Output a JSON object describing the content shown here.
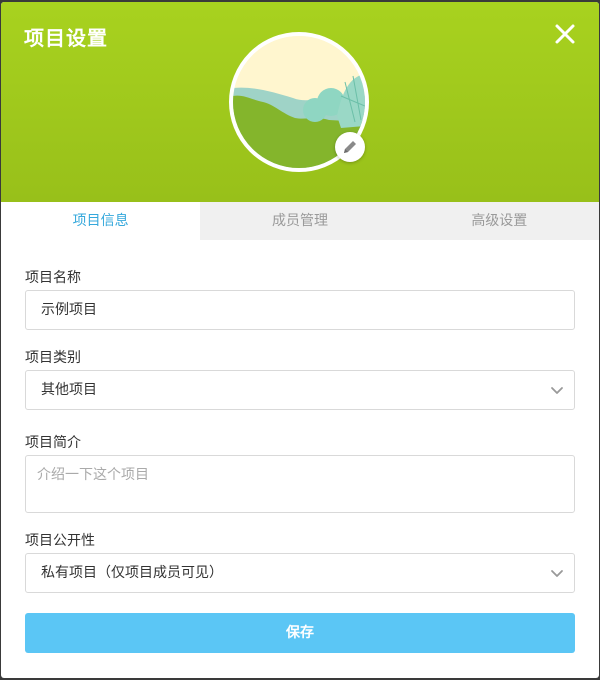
{
  "dialog": {
    "title": "项目设置",
    "close_icon": "close-icon",
    "edit_icon": "pencil-icon",
    "header_color": "#a4cf1e"
  },
  "tabs": [
    {
      "label": "项目信息",
      "active": true
    },
    {
      "label": "成员管理",
      "active": false
    },
    {
      "label": "高级设置",
      "active": false
    }
  ],
  "form": {
    "name": {
      "label": "项目名称",
      "value": "示例项目"
    },
    "category": {
      "label": "项目类别",
      "value": "其他项目"
    },
    "description": {
      "label": "项目简介",
      "placeholder": "介绍一下这个项目",
      "value": ""
    },
    "visibility": {
      "label": "项目公开性",
      "value": "私有项目（仅项目成员可见）"
    },
    "save_label": "保存"
  },
  "colors": {
    "accent": "#35a8dc",
    "save_button": "#5bc6f5"
  }
}
